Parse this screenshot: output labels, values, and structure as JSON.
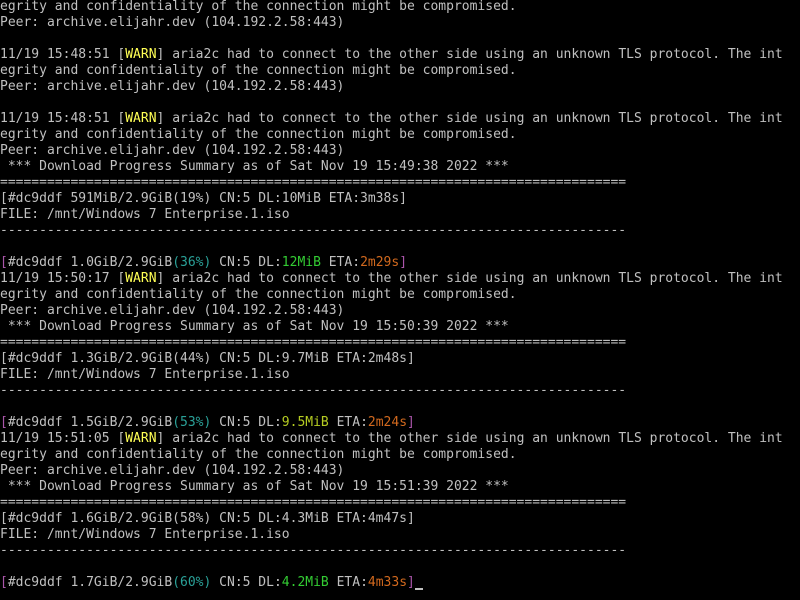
{
  "terminal": {
    "colors": {
      "background": "#000000",
      "default": "#c0c0c0",
      "yellow": "#ffff55",
      "purple": "#aa55aa",
      "cyan": "#2aa198",
      "green": "#33cc33",
      "lime": "#b5cc22",
      "orange": "#d2691e"
    },
    "lines": [
      [
        {
          "t": "egrity and confidentiality of the connection might be compromised."
        }
      ],
      [
        {
          "t": "Peer: archive.elijahr.dev (104.192.2.58:443)"
        }
      ],
      [],
      [
        {
          "t": "11/19 15:48:51 ["
        },
        {
          "t": "WARN",
          "c": "yellow"
        },
        {
          "t": "] aria2c had to connect to the other side using an unknown TLS protocol. The int"
        }
      ],
      [
        {
          "t": "egrity and confidentiality of the connection might be compromised."
        }
      ],
      [
        {
          "t": "Peer: archive.elijahr.dev (104.192.2.58:443)"
        }
      ],
      [],
      [
        {
          "t": "11/19 15:48:51 ["
        },
        {
          "t": "WARN",
          "c": "yellow"
        },
        {
          "t": "] aria2c had to connect to the other side using an unknown TLS protocol. The int"
        }
      ],
      [
        {
          "t": "egrity and confidentiality of the connection might be compromised."
        }
      ],
      [
        {
          "t": "Peer: archive.elijahr.dev (104.192.2.58:443)"
        }
      ],
      [
        {
          "t": " *** Download Progress Summary as of Sat Nov 19 15:49:38 2022 ***"
        }
      ],
      [
        {
          "t": "================================================================================"
        }
      ],
      [
        {
          "t": "[#dc9ddf 591MiB/2.9GiB(19%) CN:5 DL:10MiB ETA:3m38s]"
        }
      ],
      [
        {
          "t": "FILE: /mnt/Windows 7 Enterprise.1.iso"
        }
      ],
      [
        {
          "t": "--------------------------------------------------------------------------------"
        }
      ],
      [],
      [
        {
          "t": "[",
          "c": "purple"
        },
        {
          "t": "#dc9ddf 1.0GiB/2.9GiB"
        },
        {
          "t": "(36%)",
          "c": "cyan"
        },
        {
          "t": " CN:5 DL:"
        },
        {
          "t": "12MiB",
          "c": "green"
        },
        {
          "t": " ETA:"
        },
        {
          "t": "2m29s",
          "c": "orange"
        },
        {
          "t": "]",
          "c": "purple"
        }
      ],
      [
        {
          "t": "11/19 15:50:17 ["
        },
        {
          "t": "WARN",
          "c": "yellow"
        },
        {
          "t": "] aria2c had to connect to the other side using an unknown TLS protocol. The int"
        }
      ],
      [
        {
          "t": "egrity and confidentiality of the connection might be compromised."
        }
      ],
      [
        {
          "t": "Peer: archive.elijahr.dev (104.192.2.58:443)"
        }
      ],
      [
        {
          "t": " *** Download Progress Summary as of Sat Nov 19 15:50:39 2022 ***"
        }
      ],
      [
        {
          "t": "================================================================================"
        }
      ],
      [
        {
          "t": "[#dc9ddf 1.3GiB/2.9GiB(44%) CN:5 DL:9.7MiB ETA:2m48s]"
        }
      ],
      [
        {
          "t": "FILE: /mnt/Windows 7 Enterprise.1.iso"
        }
      ],
      [
        {
          "t": "--------------------------------------------------------------------------------"
        }
      ],
      [],
      [
        {
          "t": "[",
          "c": "purple"
        },
        {
          "t": "#dc9ddf 1.5GiB/2.9GiB"
        },
        {
          "t": "(53%)",
          "c": "cyan"
        },
        {
          "t": " CN:5 DL:"
        },
        {
          "t": "9.5MiB",
          "c": "lime"
        },
        {
          "t": " ETA:"
        },
        {
          "t": "2m24s",
          "c": "orange"
        },
        {
          "t": "]",
          "c": "purple"
        }
      ],
      [
        {
          "t": "11/19 15:51:05 ["
        },
        {
          "t": "WARN",
          "c": "yellow"
        },
        {
          "t": "] aria2c had to connect to the other side using an unknown TLS protocol. The int"
        }
      ],
      [
        {
          "t": "egrity and confidentiality of the connection might be compromised."
        }
      ],
      [
        {
          "t": "Peer: archive.elijahr.dev (104.192.2.58:443)"
        }
      ],
      [
        {
          "t": " *** Download Progress Summary as of Sat Nov 19 15:51:39 2022 ***"
        }
      ],
      [
        {
          "t": "================================================================================"
        }
      ],
      [
        {
          "t": "[#dc9ddf 1.6GiB/2.9GiB(58%) CN:5 DL:4.3MiB ETA:4m47s]"
        }
      ],
      [
        {
          "t": "FILE: /mnt/Windows 7 Enterprise.1.iso"
        }
      ],
      [
        {
          "t": "--------------------------------------------------------------------------------"
        }
      ],
      [],
      [
        {
          "t": "[",
          "c": "purple"
        },
        {
          "t": "#dc9ddf 1.7GiB/2.9GiB"
        },
        {
          "t": "(60%)",
          "c": "cyan"
        },
        {
          "t": " CN:5 DL:"
        },
        {
          "t": "4.2MiB",
          "c": "green"
        },
        {
          "t": " ETA:"
        },
        {
          "t": "4m33s",
          "c": "orange"
        },
        {
          "t": "]",
          "c": "purple"
        }
      ]
    ]
  }
}
